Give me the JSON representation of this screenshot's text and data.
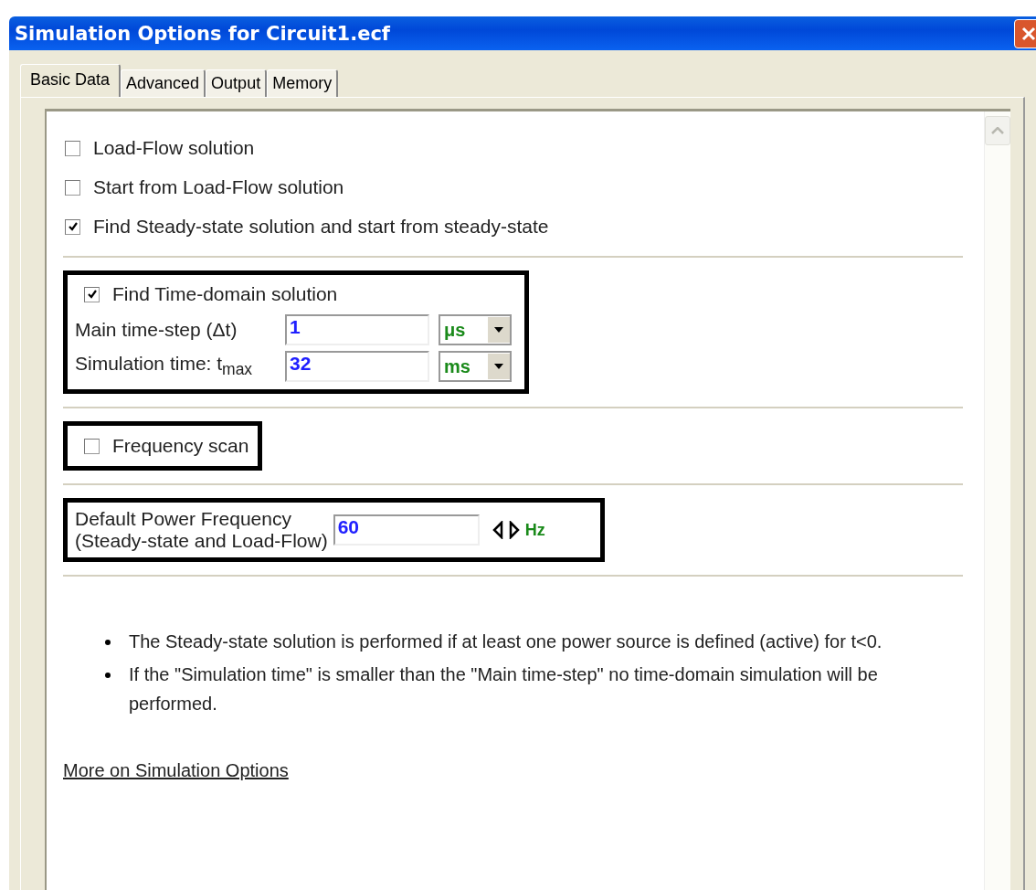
{
  "window": {
    "title": "Simulation Options for Circuit1.ecf"
  },
  "tabs": [
    {
      "label": "Basic Data",
      "selected": true
    },
    {
      "label": "Advanced",
      "selected": false
    },
    {
      "label": "Output",
      "selected": false
    },
    {
      "label": "Memory",
      "selected": false
    }
  ],
  "solution_options": [
    {
      "label": "Load-Flow solution",
      "checked": false
    },
    {
      "label": "Start from Load-Flow solution",
      "checked": false
    },
    {
      "label": "Find Steady-state solution and start from steady-state",
      "checked": true
    }
  ],
  "time_domain": {
    "label": "Find Time-domain solution",
    "checked": true,
    "fields": [
      {
        "label": "Main time-step (Δt)",
        "value": "1",
        "unit": "μs"
      },
      {
        "label": "Simulation time: t$_{max}$",
        "value": "32",
        "unit": "ms"
      }
    ]
  },
  "frequency_scan": {
    "label": "Frequency scan",
    "checked": false
  },
  "power_frequency": {
    "label_lines": [
      "Default Power Frequency",
      "(Steady-state and Load-Flow)"
    ],
    "value": "60",
    "unit": "Hz"
  },
  "notes": [
    "The Steady-state solution is performed if at least one power source is defined (active) for t<0.",
    "If the \"Simulation time\" is smaller than the \"Main time-step\" no time-domain simulation will be performed."
  ],
  "link": "More on Simulation Options"
}
